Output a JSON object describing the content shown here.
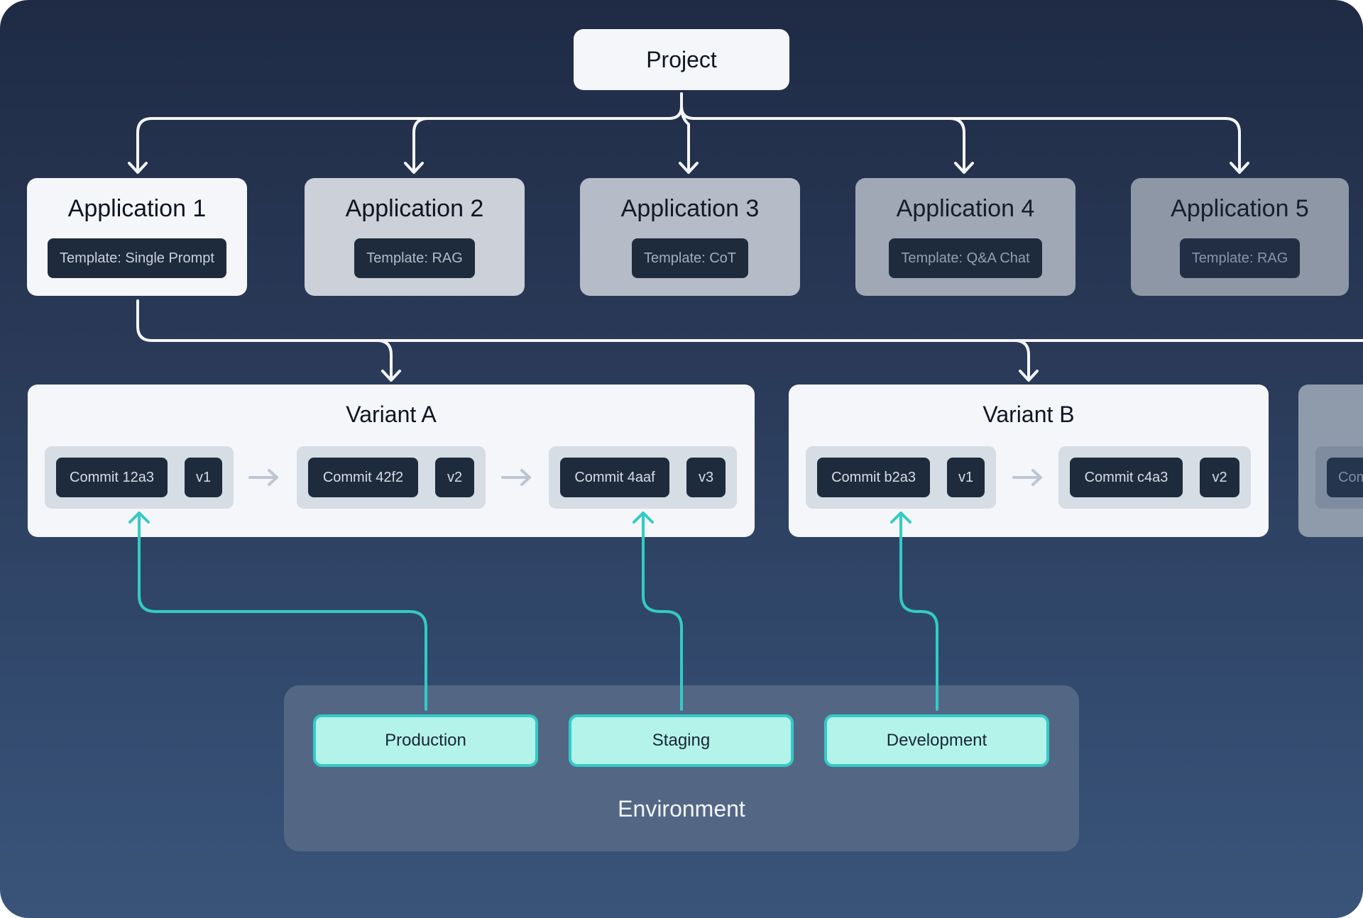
{
  "project": {
    "label": "Project"
  },
  "applications": [
    {
      "title": "Application 1",
      "template": "Template: Single Prompt",
      "emphasis": "active"
    },
    {
      "title": "Application 2",
      "template": "Template: RAG",
      "emphasis": "faded-1"
    },
    {
      "title": "Application 3",
      "template": "Template: CoT",
      "emphasis": "faded-2"
    },
    {
      "title": "Application 4",
      "template": "Template: Q&A Chat",
      "emphasis": "faded-3"
    },
    {
      "title": "Application 5",
      "template": "Template: RAG",
      "emphasis": "faded-4"
    }
  ],
  "variants": [
    {
      "title": "Variant A",
      "commits": [
        {
          "commit": "Commit 12a3",
          "version": "v1"
        },
        {
          "commit": "Commit 42f2",
          "version": "v2"
        },
        {
          "commit": "Commit 4aaf",
          "version": "v3"
        }
      ]
    },
    {
      "title": "Variant B",
      "commits": [
        {
          "commit": "Commit b2a3",
          "version": "v1"
        },
        {
          "commit": "Commit c4a3",
          "version": "v2"
        }
      ]
    },
    {
      "title": "",
      "commits": [
        {
          "commit": "Com",
          "version": ""
        }
      ],
      "partially_visible": true
    }
  ],
  "environment": {
    "label": "Environment",
    "targets": [
      {
        "name": "Production",
        "points_to": "Commit 12a3"
      },
      {
        "name": "Staging",
        "points_to": "Commit 4aaf"
      },
      {
        "name": "Development",
        "points_to": "Commit b2a3"
      }
    ]
  },
  "colors": {
    "background_top": "#1f2b45",
    "background_bottom": "#3a5479",
    "card": "#f5f6fa",
    "pill": "#1e2b3d",
    "connector": "#f5f6fa",
    "environment_accent": "#33cbc5",
    "environment_fill": "#b3f3ea",
    "environment_panel": "#536785",
    "commit_arrow": "#bcc6d2"
  }
}
